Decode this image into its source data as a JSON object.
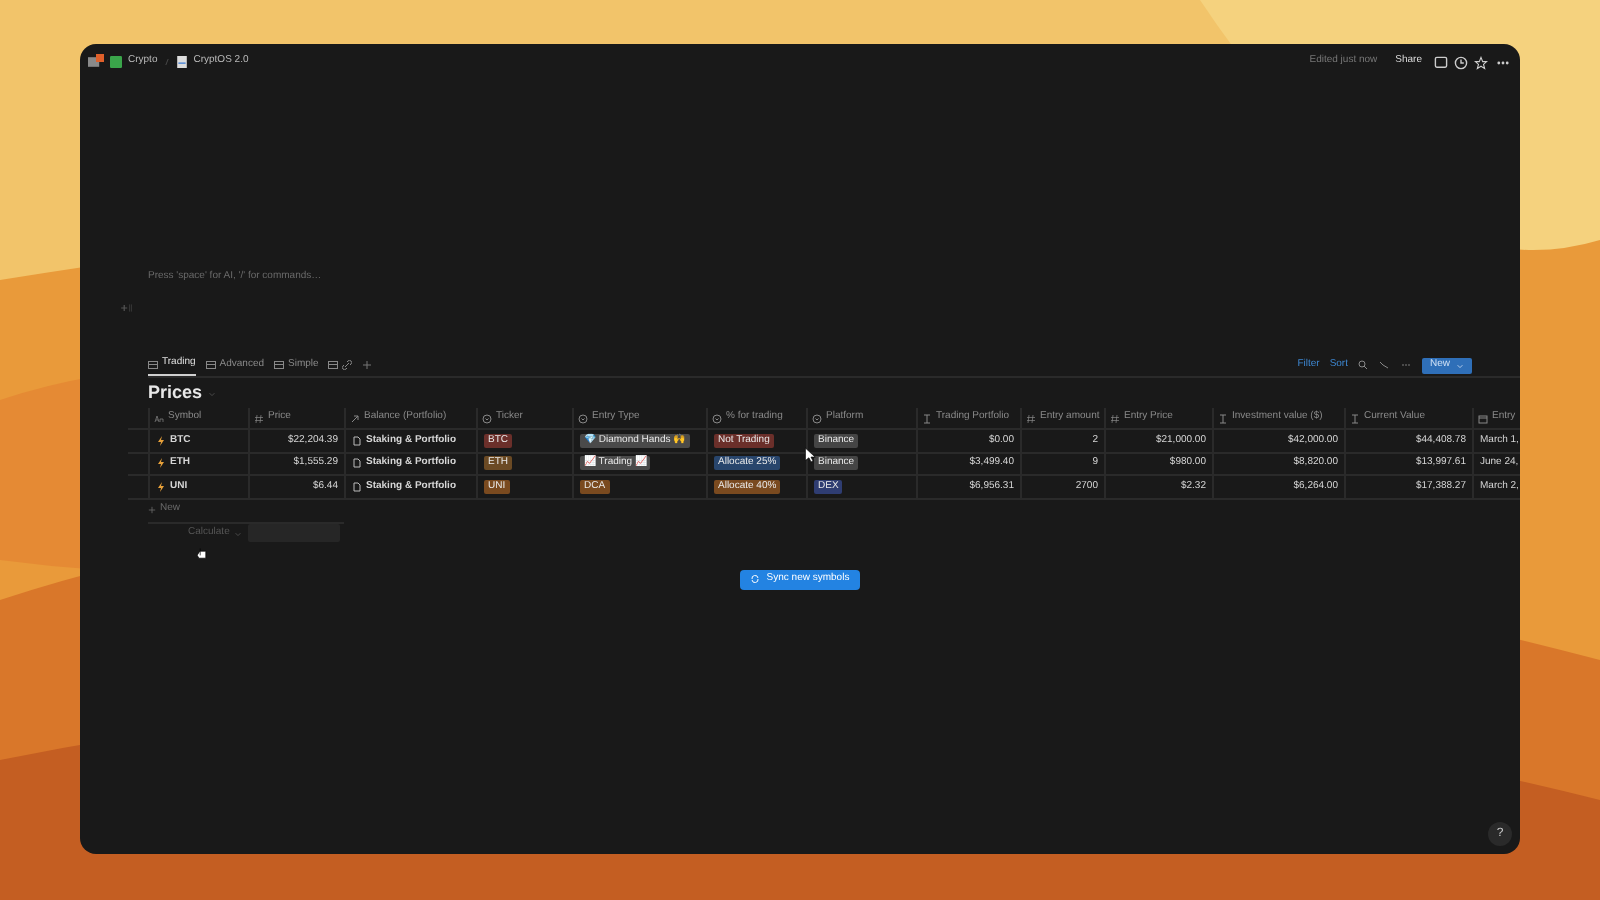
{
  "breadcrumb": [
    {
      "text": "Crypto"
    },
    {
      "text": "CryptOS 2.0"
    }
  ],
  "topbar": {
    "edited": "Edited just now",
    "share": "Share"
  },
  "editor_placeholder": "Press 'space' for AI, '/' for commands…",
  "views": [
    {
      "kind": "text",
      "label": "Trading",
      "selected": true
    },
    {
      "kind": "text",
      "label": "Advanced",
      "selected": false
    },
    {
      "kind": "text",
      "label": "Simple",
      "selected": false
    },
    {
      "kind": "link",
      "selected": false
    }
  ],
  "toolbar": {
    "filter": "Filter",
    "sort": "Sort",
    "new": "New"
  },
  "database": {
    "title": "Prices",
    "columns": [
      {
        "label": "Symbol",
        "kind": "title"
      },
      {
        "label": "Price",
        "kind": "number"
      },
      {
        "label": "Balance (Portfolio)",
        "kind": "relation"
      },
      {
        "label": "Ticker",
        "kind": "select"
      },
      {
        "label": "Entry Type",
        "kind": "select"
      },
      {
        "label": "% for trading",
        "kind": "select"
      },
      {
        "label": "Platform",
        "kind": "select"
      },
      {
        "label": "Trading Portfolio",
        "kind": "rollup"
      },
      {
        "label": "Entry amount",
        "kind": "number"
      },
      {
        "label": "Entry Price",
        "kind": "number"
      },
      {
        "label": "Investment value ($)",
        "kind": "rollup"
      },
      {
        "label": "Current Value",
        "kind": "rollup"
      },
      {
        "label": "Entry",
        "kind": "date"
      }
    ],
    "rows": [
      {
        "cells": [
          "BTC",
          "$22,204.39",
          "Staking & Portfolio",
          {
            "text": "BTC",
            "color": "#6b2f2a"
          },
          {
            "text": "💎 Diamond Hands 🙌",
            "color": "#4a4a4a"
          },
          {
            "text": "Not Trading",
            "color": "#6b2f2a"
          },
          {
            "text": "Binance",
            "color": "#454545"
          },
          "$0.00",
          "2",
          "$21,000.00",
          "$42,000.00",
          "$44,408.78",
          "March 1,"
        ]
      },
      {
        "cells": [
          "ETH",
          "$1,555.29",
          "Staking & Portfolio",
          {
            "text": "ETH",
            "color": "#6b4a24"
          },
          {
            "text": "📈 Trading 📈",
            "color": "#4a4a4a"
          },
          {
            "text": "Allocate 25%",
            "color": "#28456c"
          },
          {
            "text": "Binance",
            "color": "#454545"
          },
          "$3,499.40",
          "9",
          "$980.00",
          "$8,820.00",
          "$13,997.61",
          "June 24,"
        ]
      },
      {
        "cells": [
          "UNI",
          "$6.44",
          "Staking & Portfolio",
          {
            "text": "UNI",
            "color": "#7a4a1f"
          },
          {
            "text": "DCA",
            "color": "#7a4a1f"
          },
          {
            "text": "Allocate 40%",
            "color": "#7a4a1f"
          },
          {
            "text": "DEX",
            "color": "#2f3d72"
          },
          "$6,956.31",
          "2700",
          "$2.32",
          "$6,264.00",
          "$17,388.27",
          "March 2,"
        ]
      }
    ]
  },
  "new_row": "New",
  "calculate": "Calculate",
  "sync_button": "Sync new symbols",
  "help": "?"
}
